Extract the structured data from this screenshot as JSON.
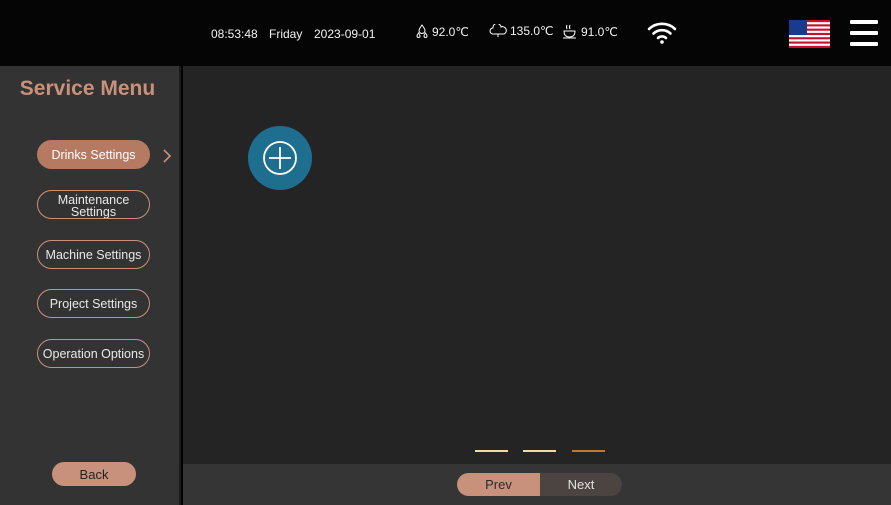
{
  "status_bar": {
    "time": "08:53:48",
    "day": "Friday",
    "date": "2023-09-01",
    "temp_1": "92.0℃",
    "temp_2": "135.0℃",
    "temp_3": "91.0℃",
    "temp_1_icon": "water-drops-icon",
    "temp_2_icon": "steam-cloud-icon",
    "temp_3_icon": "hot-cup-icon",
    "wifi_icon": "wifi-icon",
    "language_flag_icon": "us-flag-icon",
    "menu_icon": "hamburger-menu-icon"
  },
  "sidebar": {
    "title": "Service Menu",
    "items": [
      {
        "label": "Drinks Settings",
        "active": true
      },
      {
        "label_line1": "Maintenance",
        "label_line2": "Settings",
        "active": false
      },
      {
        "label": "Machine Settings",
        "active": false
      },
      {
        "label": "Project Settings",
        "active": false
      },
      {
        "label": "Operation Options",
        "active": false
      }
    ],
    "back_label": "Back"
  },
  "main": {
    "add_icon": "plus-circle-icon",
    "page_indicator": {
      "pages": 3,
      "current": 3
    }
  },
  "pagination": {
    "prev_label": "Prev",
    "next_label": "Next"
  },
  "colors": {
    "accent": "#c8917b",
    "active_button": "#b67a63",
    "add_button": "#1e6f8f",
    "sidebar_bg": "#333333",
    "main_bg": "#242424"
  }
}
